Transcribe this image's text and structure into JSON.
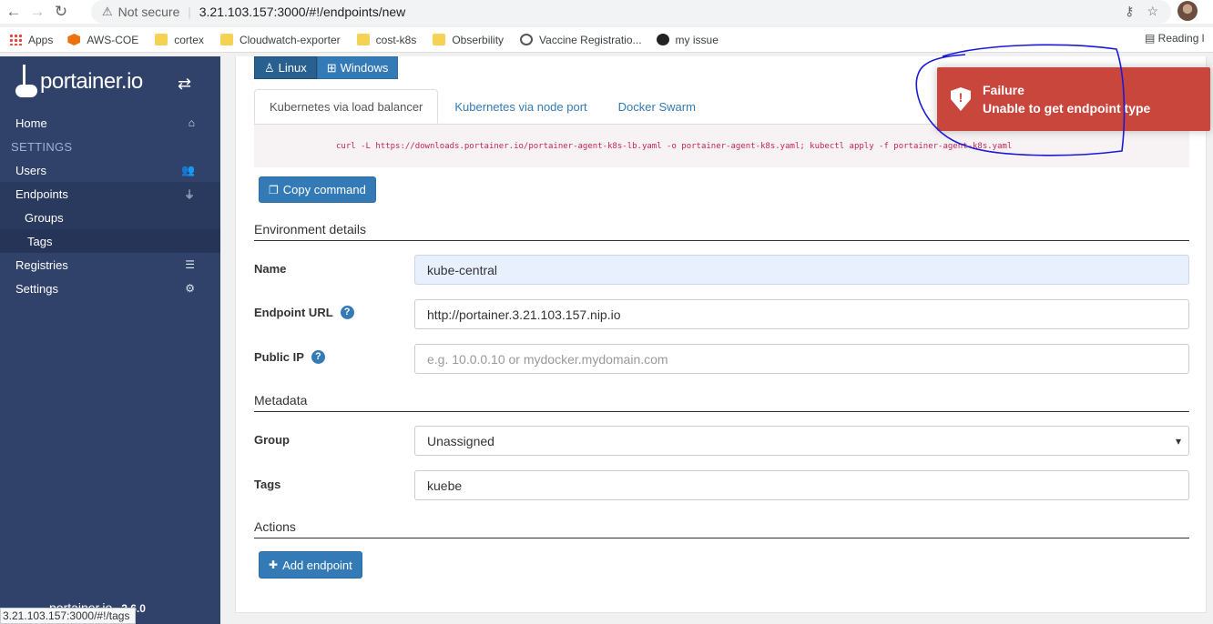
{
  "browser": {
    "security_label": "Not secure",
    "url": "3.21.103.157:3000/#!/endpoints/new",
    "bookmarks": [
      "Apps",
      "AWS-COE",
      "cortex",
      "Cloudwatch-exporter",
      "cost-k8s",
      "Obserbility",
      "Vaccine Registratio...",
      "my issue"
    ],
    "reading_list": "Reading l",
    "status_url": "3.21.103.157:3000/#!/tags"
  },
  "sidebar": {
    "logo": "portainer.io",
    "items": [
      {
        "label": "Home"
      },
      {
        "label": "SETTINGS"
      },
      {
        "label": "Users"
      },
      {
        "label": "Endpoints"
      },
      {
        "label": "Groups"
      },
      {
        "label": "Tags"
      },
      {
        "label": "Registries"
      },
      {
        "label": "Settings"
      }
    ],
    "footer_logo": "portainer.io",
    "version": "2.6.0"
  },
  "main": {
    "os_buttons": [
      "Linux",
      "Windows"
    ],
    "tabs": [
      "Kubernetes via load balancer",
      "Kubernetes via node port",
      "Docker Swarm"
    ],
    "command": "curl -L https://downloads.portainer.io/portainer-agent-k8s-lb.yaml -o portainer-agent-k8s.yaml; kubectl apply -f portainer-agent-k8s.yaml",
    "copy_button": "Copy command",
    "sections": {
      "environment": "Environment details",
      "metadata": "Metadata",
      "actions": "Actions"
    },
    "fields": {
      "name_label": "Name",
      "name_value": "kube-central",
      "url_label": "Endpoint URL",
      "url_value": "http://portainer.3.21.103.157.nip.io",
      "ip_label": "Public IP",
      "ip_placeholder": "e.g. 10.0.0.10 or mydocker.mydomain.com",
      "group_label": "Group",
      "group_value": "Unassigned",
      "tags_label": "Tags",
      "tags_value": "kuebe"
    },
    "add_button": "Add endpoint"
  },
  "toast": {
    "title": "Failure",
    "message": "Unable to get endpoint type",
    "color": "#c9463d"
  },
  "colors": {
    "sidebar": "#30426a",
    "primary": "#337ab7",
    "annotation": "#1a1ad6"
  }
}
